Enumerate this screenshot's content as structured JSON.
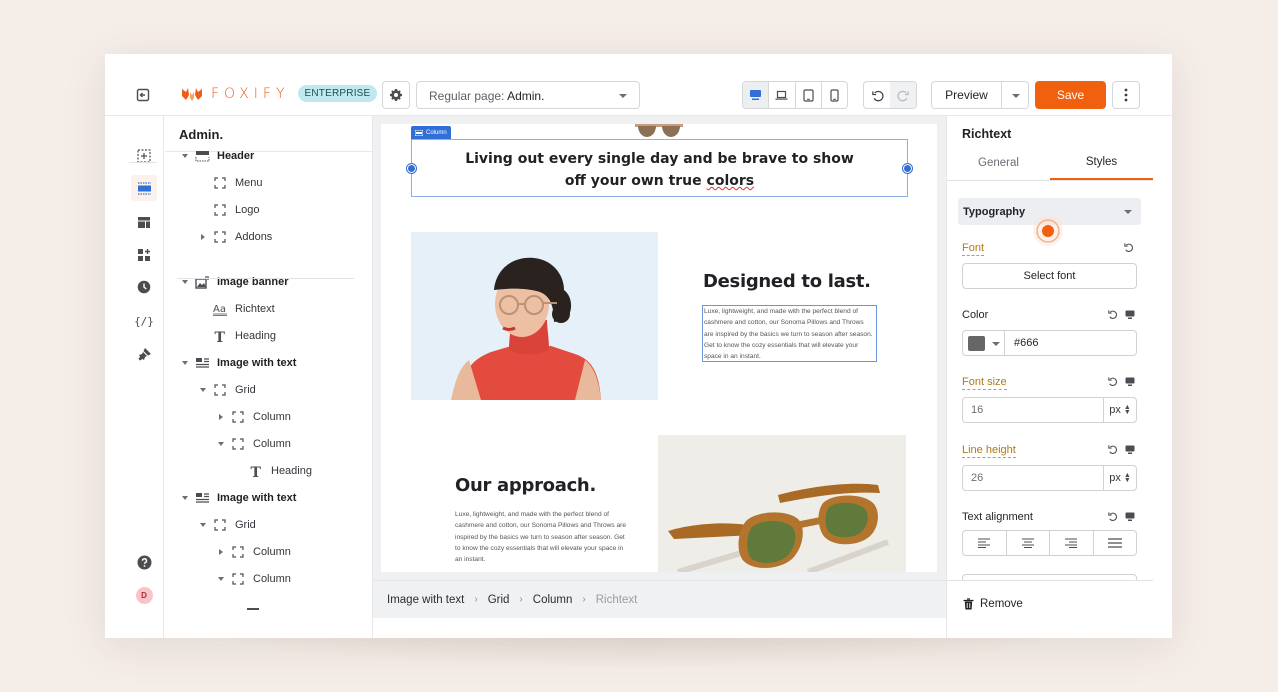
{
  "app": {
    "brand": "FOXIFY",
    "plan_badge": "ENTERPRISE",
    "brand_color": "#f0600f"
  },
  "toolbar": {
    "page_selector_prefix": "Regular page:",
    "page_selector_value": "Admin.",
    "devices": [
      {
        "name": "desktop",
        "active": true
      },
      {
        "name": "laptop",
        "active": false
      },
      {
        "name": "tablet",
        "active": false
      },
      {
        "name": "mobile",
        "active": false
      }
    ],
    "preview_label": "Preview",
    "save_label": "Save"
  },
  "rail": {
    "items": [
      "add-section",
      "sections",
      "templates",
      "apps",
      "history",
      "code",
      "theme-styles"
    ],
    "active": "sections",
    "avatar_initial": "D"
  },
  "tree": {
    "title": "Admin.",
    "nodes": [
      {
        "label": "Header",
        "icon": "header-icon",
        "level": 0,
        "toggle": "open",
        "section": true
      },
      {
        "label": "Menu",
        "icon": "frame-icon",
        "level": 1,
        "toggle": "none"
      },
      {
        "label": "Logo",
        "icon": "frame-icon",
        "level": 1,
        "toggle": "none"
      },
      {
        "label": "Addons",
        "icon": "frame-icon",
        "level": 1,
        "toggle": "closed"
      },
      {
        "label": "Image banner",
        "icon": "image-banner-icon",
        "level": 0,
        "toggle": "open",
        "section": true
      },
      {
        "label": "Richtext",
        "icon": "richtext-icon",
        "level": 1,
        "toggle": "none"
      },
      {
        "label": "Heading",
        "icon": "heading-icon",
        "level": 1,
        "toggle": "none"
      },
      {
        "label": "Image with text",
        "icon": "image-text-icon",
        "level": 0,
        "toggle": "open",
        "section": true
      },
      {
        "label": "Grid",
        "icon": "frame-icon",
        "level": 1,
        "toggle": "open"
      },
      {
        "label": "Column",
        "icon": "frame-icon",
        "level": 2,
        "toggle": "closed"
      },
      {
        "label": "Column",
        "icon": "frame-icon",
        "level": 2,
        "toggle": "open"
      },
      {
        "label": "Heading",
        "icon": "heading-icon",
        "level": 3,
        "toggle": "none"
      },
      {
        "label": "Image with text",
        "icon": "image-text-icon",
        "level": 0,
        "toggle": "open",
        "section": true
      },
      {
        "label": "Grid",
        "icon": "frame-icon",
        "level": 1,
        "toggle": "open"
      },
      {
        "label": "Column",
        "icon": "frame-icon",
        "level": 2,
        "toggle": "closed"
      },
      {
        "label": "Column",
        "icon": "frame-icon",
        "level": 2,
        "toggle": "open"
      }
    ]
  },
  "canvas": {
    "selection_tag": "Column",
    "hero_line1": "Living out every single day and be brave to show",
    "hero_line2_a": "off your own true ",
    "hero_line2_b": "colors",
    "block1": {
      "heading": "Designed to last.",
      "body": "Luxe, lightweight, and made with the perfect blend of cashmere and cotton, our Sonoma Pillows and Throws are inspired by the basics we turn to season after season. Get to know the cozy essentials that will elevate your space in an instant."
    },
    "block2": {
      "heading": "Our approach.",
      "body": "Luxe, lightweight, and made with the perfect blend of cashmere and cotton, our Sonoma Pillows and Throws are inspired by the basics we turn to season after season. Get to know the cozy essentials that will elevate your space in an instant."
    }
  },
  "breadcrumb": [
    "Image with text",
    "Grid",
    "Column",
    "Richtext"
  ],
  "panel": {
    "title": "Richtext",
    "tabs": [
      {
        "label": "General",
        "active": false
      },
      {
        "label": "Styles",
        "active": true
      }
    ],
    "section": "Typography",
    "font_label": "Font",
    "font_button": "Select font",
    "color_label": "Color",
    "color_value": "#666",
    "font_size_label": "Font size",
    "font_size_value": "16",
    "font_size_unit": "px",
    "line_height_label": "Line height",
    "line_height_value": "26",
    "line_height_unit": "px",
    "text_alignment_label": "Text alignment",
    "alignments": [
      "left",
      "center",
      "right",
      "justify"
    ],
    "remove_label": "Remove"
  }
}
